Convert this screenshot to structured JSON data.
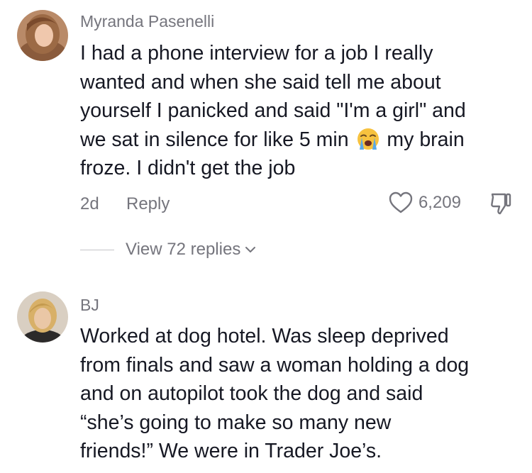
{
  "comments": [
    {
      "username": "Myranda Pasenelli",
      "text_lines": [
        "I had a phone interview for a job I really",
        "wanted and when she said tell me about",
        "yourself I panicked and said \"I'm a girl\" and"
      ],
      "text_line4_before_emoji": "we sat in silence for like 5 min",
      "text_line4_after_emoji": "my brain",
      "text_line5": "froze. I didn't get the job",
      "emoji_icon": "loudly-crying-face-icon",
      "age": "2d",
      "reply_label": "Reply",
      "like_count": "6,209",
      "view_replies_label": "View 72 replies"
    },
    {
      "username": "BJ",
      "text_lines": [
        "Worked at dog hotel. Was sleep deprived",
        "from finals and saw a woman holding a dog",
        "and on autopilot took the dog and said",
        "“she’s going to make so many new",
        "friends!” We were in Trader Joe’s."
      ]
    }
  ],
  "colors": {
    "text_primary": "#161823",
    "text_secondary": "#75757d",
    "emoji_face": "#f7c23f",
    "emoji_tears": "#5aa9e6"
  }
}
